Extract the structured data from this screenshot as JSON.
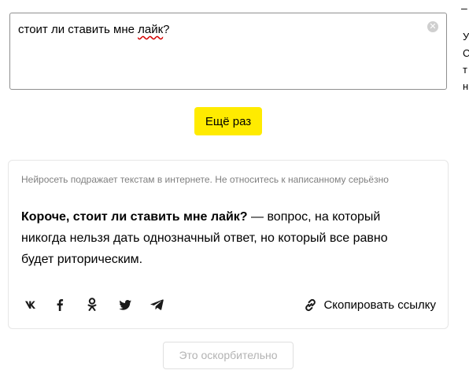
{
  "prompt": {
    "text_before": "стоит ли ставить мне ",
    "misspelled_word": "лайк",
    "text_after": "?",
    "clear_icon": "close-icon"
  },
  "retry_button": {
    "label": "Ещё раз"
  },
  "result": {
    "disclaimer": "Нейросеть подражает текстам в интернете. Не относитесь к написанному серьёзно",
    "answer_bold": "Короче, стоит ли ставить мне лайк?",
    "answer_rest": " — вопрос, на который никогда нельзя дать однозначный ответ, но который все равно будет риторическим.",
    "share": [
      {
        "network": "vk",
        "icon": "vk-icon"
      },
      {
        "network": "facebook",
        "icon": "facebook-icon"
      },
      {
        "network": "odnoklassniki",
        "icon": "odnoklassniki-icon"
      },
      {
        "network": "twitter",
        "icon": "twitter-icon"
      },
      {
        "network": "telegram",
        "icon": "telegram-icon"
      }
    ],
    "copy_link_label": "Скопировать ссылку"
  },
  "offensive_button": {
    "label": "Это оскорбительно"
  },
  "side": {
    "dash": "–",
    "letters": [
      "У",
      "С",
      "т",
      "н"
    ]
  }
}
